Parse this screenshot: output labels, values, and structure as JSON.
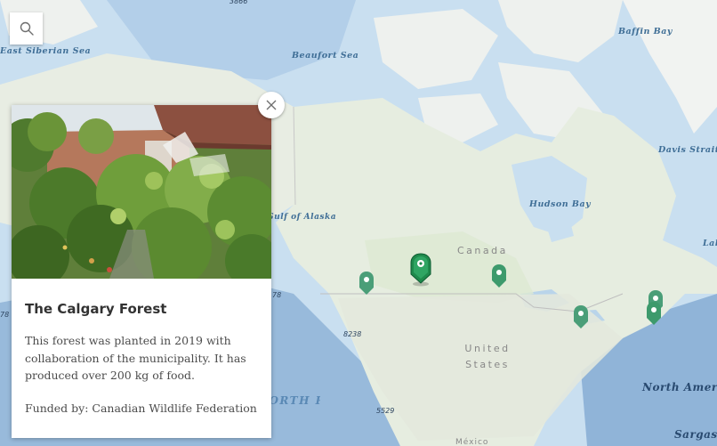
{
  "map": {
    "labels": {
      "east_siberian_sea": "East Siberian Sea",
      "beaufort_sea": "Beaufort Sea",
      "baffin_bay": "Baffin Bay",
      "davis_strait": "Davis Strait",
      "hudson_bay": "Hudson Bay",
      "gulf_of_alaska": "Gulf of Alaska",
      "north_american_basin": "North American Basin",
      "sargasso": "Sargas",
      "labrador": "Lab",
      "north_pacific_ocean": "NORTH PACIFIC OCEAN",
      "canada": "Canada",
      "united_states": "United States",
      "mexico": "México"
    },
    "depths": {
      "d1": "3866",
      "d2": "8238",
      "d3": "5529",
      "d4": "78",
      "d5": "78"
    },
    "colors": {
      "ocean": "#c9dff0",
      "land": "#e6ede0",
      "pin": "#3d9a6c",
      "pin_selected": "#1f8a4c"
    },
    "pins": [
      {
        "id": "pin-vancouver",
        "selected": false
      },
      {
        "id": "pin-calgary",
        "selected": true
      },
      {
        "id": "pin-saskatchewan",
        "selected": false
      },
      {
        "id": "pin-toronto",
        "selected": false
      },
      {
        "id": "pin-quebec-1",
        "selected": false
      },
      {
        "id": "pin-quebec-2",
        "selected": false
      }
    ]
  },
  "search": {
    "icon": "search-icon"
  },
  "popup": {
    "title": "The Calgary Forest",
    "description": "This forest was planted in 2019 with collaboration of the municipality. It has produced over 200 kg of food.",
    "funded_by": "Funded by: Canadian Wildlife Federation",
    "close_icon": "close-icon"
  }
}
